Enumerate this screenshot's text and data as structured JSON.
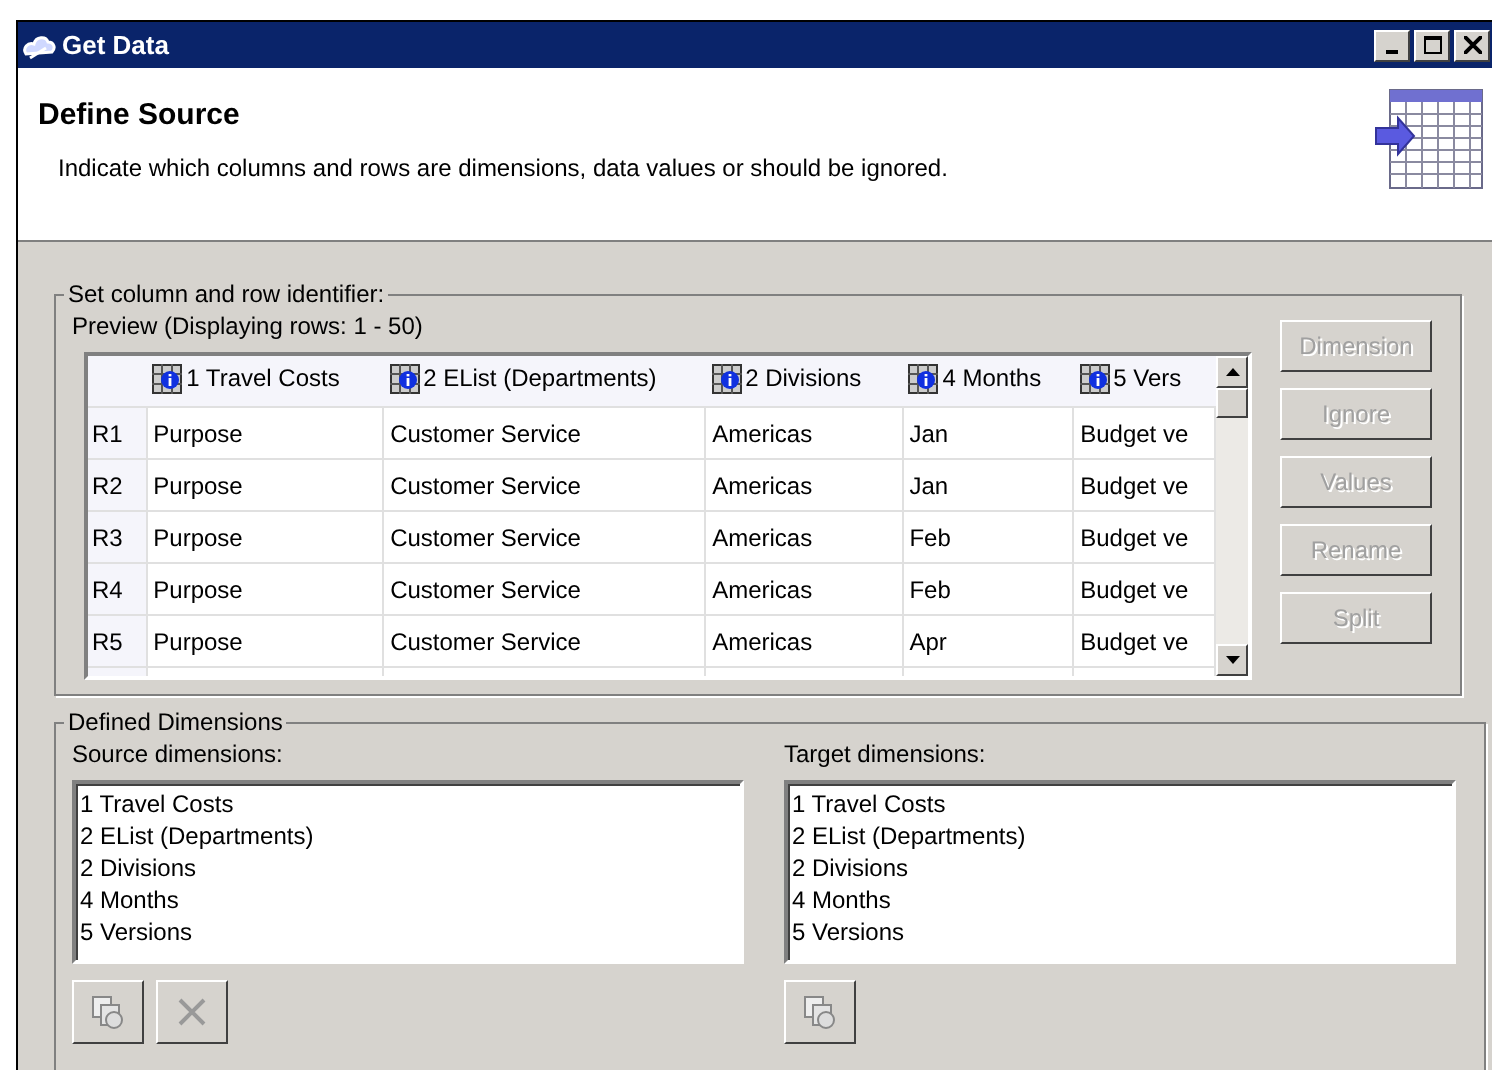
{
  "window": {
    "title": "Get Data"
  },
  "header": {
    "title": "Define Source",
    "description": "Indicate which columns and rows are dimensions, data values or should be ignored."
  },
  "identifier_group": {
    "title": "Set column and row identifier:",
    "preview_label": "Preview (Displaying rows: 1 - 50)",
    "columns": [
      "1 Travel Costs",
      "2 EList (Departments)",
      "2 Divisions",
      "4 Months",
      "5 Vers"
    ],
    "rows": [
      {
        "header": "R1",
        "cells": [
          "Purpose",
          "Customer Service",
          "Americas",
          "Jan",
          "Budget ve"
        ]
      },
      {
        "header": "R2",
        "cells": [
          "Purpose",
          "Customer Service",
          "Americas",
          "Jan",
          "Budget ve"
        ]
      },
      {
        "header": "R3",
        "cells": [
          "Purpose",
          "Customer Service",
          "Americas",
          "Feb",
          "Budget ve"
        ]
      },
      {
        "header": "R4",
        "cells": [
          "Purpose",
          "Customer Service",
          "Americas",
          "Feb",
          "Budget ve"
        ]
      },
      {
        "header": "R5",
        "cells": [
          "Purpose",
          "Customer Service",
          "Americas",
          "Apr",
          "Budget ve"
        ]
      }
    ],
    "buttons": [
      {
        "label": "Dimension",
        "disabled": true
      },
      {
        "label": "Ignore",
        "disabled": true
      },
      {
        "label": "Values",
        "disabled": true
      },
      {
        "label": "Rename",
        "disabled": true
      },
      {
        "label": "Split",
        "disabled": true
      }
    ]
  },
  "dimensions_group": {
    "title": "Defined Dimensions",
    "source": {
      "label": "Source dimensions:",
      "items": [
        "1 Travel Costs",
        "2 EList (Departments)",
        "2 Divisions",
        "4 Months",
        "5 Versions"
      ],
      "tools": [
        {
          "kind": "copy"
        },
        {
          "kind": "delete"
        }
      ]
    },
    "target": {
      "label": "Target dimensions:",
      "items": [
        "1 Travel Costs",
        "2 EList (Departments)",
        "2 Divisions",
        "4 Months",
        "5 Versions"
      ],
      "tools": [
        {
          "kind": "copy"
        }
      ]
    }
  }
}
